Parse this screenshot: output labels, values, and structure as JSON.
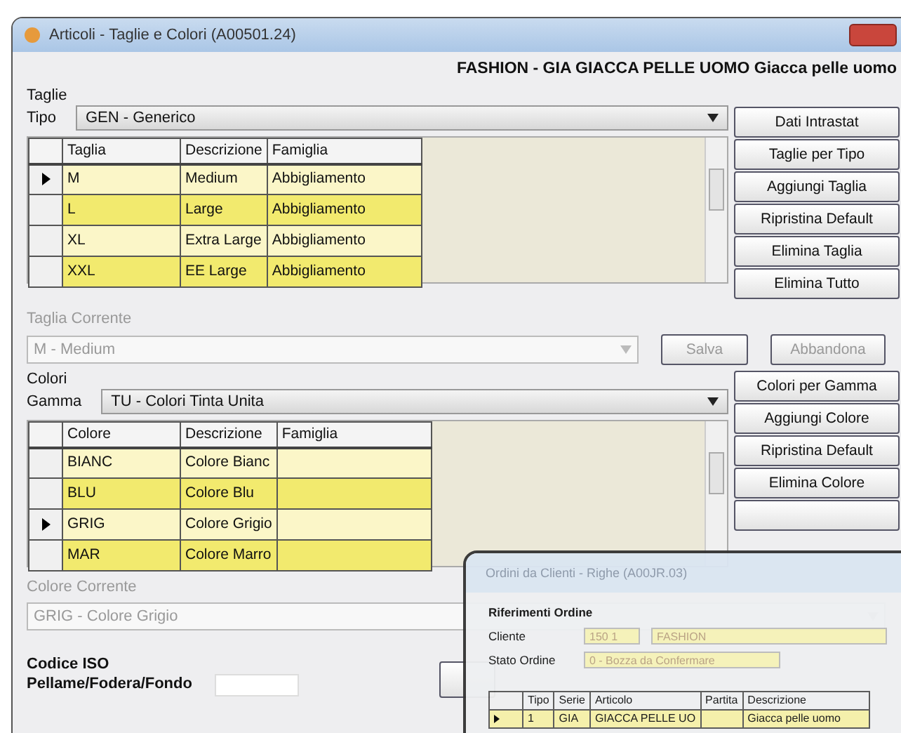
{
  "window": {
    "title": "Articoli - Taglie e Colori  (A00501.24)",
    "header": "FASHION - GIA GIACCA PELLE UOMO Giacca pelle uomo"
  },
  "taglie": {
    "section": "Taglie",
    "type_label": "Tipo",
    "type_value": "GEN - Generico",
    "columns": [
      "Taglia",
      "Descrizione",
      "Famiglia"
    ],
    "rows": [
      {
        "cells": [
          "M",
          "Medium",
          "Abbigliamento"
        ],
        "selected": true
      },
      {
        "cells": [
          "L",
          "Large",
          "Abbigliamento"
        ],
        "selected": false
      },
      {
        "cells": [
          "XL",
          "Extra Large",
          "Abbigliamento"
        ],
        "selected": false
      },
      {
        "cells": [
          "XXL",
          "EE Large",
          "Abbigliamento"
        ],
        "selected": false
      }
    ],
    "buttons": [
      "Dati Intrastat",
      "Taglie per Tipo",
      "Aggiungi Taglia",
      "Ripristina Default",
      "Elimina Taglia",
      "Elimina Tutto"
    ],
    "current_label": "Taglia Corrente",
    "current_value": "M - Medium",
    "save": "Salva",
    "cancel": "Abbandona"
  },
  "colori": {
    "section": "Colori",
    "type_label": "Gamma",
    "type_value": "TU - Colori Tinta Unita",
    "columns": [
      "Colore",
      "Descrizione",
      "Famiglia"
    ],
    "rows": [
      {
        "cells": [
          "BIANC",
          "Colore Bianc",
          ""
        ],
        "selected": false
      },
      {
        "cells": [
          "BLU",
          "Colore Blu",
          ""
        ],
        "selected": false
      },
      {
        "cells": [
          "GRIG",
          "Colore Grigio",
          ""
        ],
        "selected": true
      },
      {
        "cells": [
          "MAR",
          "Colore Marro",
          ""
        ],
        "selected": false
      }
    ],
    "buttons": [
      "Colori per Gamma",
      "Aggiungi Colore",
      "Ripristina Default",
      "Elimina Colore"
    ],
    "current_label": "Colore Corrente",
    "current_value": "GRIG - Colore Grigio"
  },
  "iso": {
    "label_1": "Codice ISO",
    "label_2": "Pellame/Fodera/Fondo"
  },
  "overlay_window": {
    "title": "Ordini da Clienti - Righe  (A00JR.03)",
    "section": "Riferimenti Ordine",
    "client_label": "Cliente",
    "client_code": "150  1",
    "client_name": "FASHION",
    "status_label": "Stato Ordine",
    "status_value": "0 - Bozza da Confermare",
    "columns": [
      "Tipo",
      "Serie",
      "Articolo",
      "Partita",
      "Descrizione"
    ],
    "rows": [
      {
        "cells": [
          "1",
          "GIA",
          "GIACCA PELLE UO",
          "",
          "Giacca pelle uomo"
        ],
        "selected": true
      }
    ]
  }
}
